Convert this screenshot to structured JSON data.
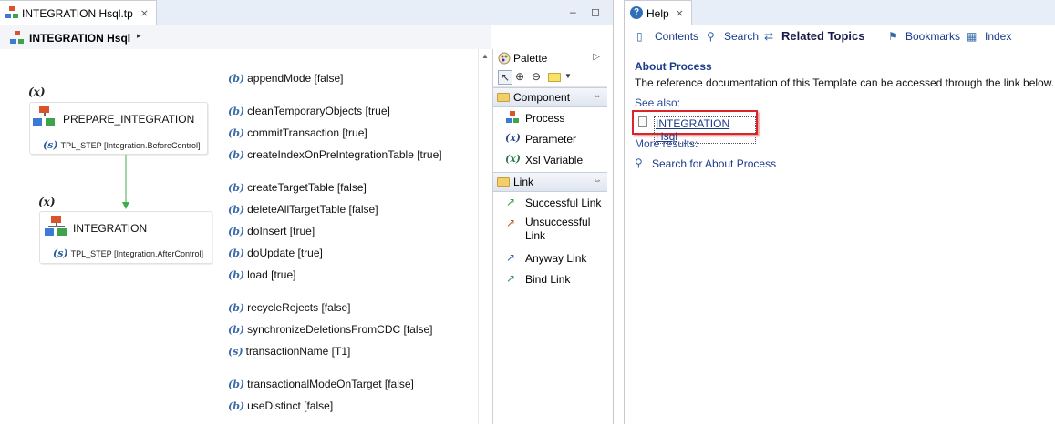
{
  "editor": {
    "tab_title": "INTEGRATION Hsql.tp",
    "tab_close": "⨯",
    "minimize": "–",
    "maximize": "◻",
    "header_title": "INTEGRATION Hsql",
    "header_chevron": "▸",
    "scroll_up": "▲"
  },
  "diagram": {
    "var_marker": "(x)",
    "nodes": [
      {
        "title": "PREPARE_INTEGRATION",
        "step_marker": "(s)",
        "step": "TPL_STEP [Integration.BeforeControl]"
      },
      {
        "title": "INTEGRATION",
        "step_marker": "(s)",
        "step": "TPL_STEP [Integration.AfterControl]"
      }
    ]
  },
  "parameters": [
    {
      "marker": "(b)",
      "text": "appendMode [false]"
    },
    {
      "marker": "(b)",
      "text": "cleanTemporaryObjects  [true]"
    },
    {
      "marker": "(b)",
      "text": "commitTransaction [true]"
    },
    {
      "marker": "(b)",
      "text": "createIndexOnPreIntegrationTable [true]"
    },
    {
      "marker": "(b)",
      "text": "createTargetTable [false]"
    },
    {
      "marker": "(b)",
      "text": "deleteAllTargetTable [false]"
    },
    {
      "marker": "(b)",
      "text": "doInsert [true]"
    },
    {
      "marker": "(b)",
      "text": "doUpdate [true]"
    },
    {
      "marker": "(b)",
      "text": "load [true]"
    },
    {
      "marker": "(b)",
      "text": "recycleRejects [false]"
    },
    {
      "marker": "(b)",
      "text": "synchronizeDeletionsFromCDC [false]"
    },
    {
      "marker": "(s)",
      "text": "transactionName [T1]"
    },
    {
      "marker": "(b)",
      "text": "transactionalModeOnTarget [false]"
    },
    {
      "marker": "(b)",
      "text": "useDistinct [false]"
    }
  ],
  "palette": {
    "title": "Palette",
    "arrow": "▷",
    "drawer_toggle": "⇔",
    "component_drawer": "Component",
    "component_items": [
      "Process",
      "Parameter",
      "Xsl Variable"
    ],
    "link_drawer": "Link",
    "link_items": [
      "Successful Link",
      "Unsuccessful Link",
      "Anyway Link",
      "Bind Link"
    ]
  },
  "help": {
    "tab_label": "Help",
    "tab_close": "⨯",
    "nav": {
      "contents": "Contents",
      "search": "Search",
      "related_topics": "Related Topics",
      "bookmarks": "Bookmarks",
      "index": "Index"
    },
    "section_title": "About Process",
    "description": "The reference documentation of this Template can be accessed through the link below.",
    "see_also": "See also:",
    "doc_link": "INTEGRATION Hsql",
    "more_results": "More results:",
    "search_about": "Search for About Process"
  }
}
